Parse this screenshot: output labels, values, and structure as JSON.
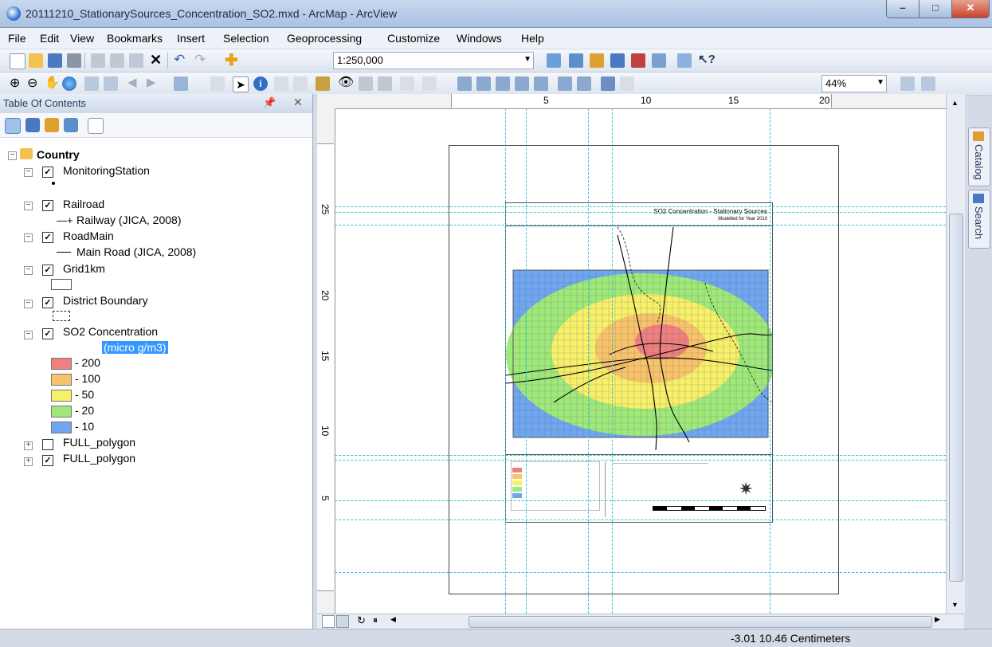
{
  "window": {
    "title": "20111210_StationarySources_Concentration_SO2.mxd - ArcMap - ArcView"
  },
  "menu": [
    "File",
    "Edit",
    "View",
    "Bookmarks",
    "Insert",
    "Selection",
    "Geoprocessing",
    "Customize",
    "Windows",
    "Help"
  ],
  "toolbar": {
    "scale": "1:250,000",
    "zoom": "44%"
  },
  "toc": {
    "title": "Table Of Contents",
    "root": "Country",
    "layers": [
      {
        "name": "MonitoringStation",
        "checked": true
      },
      {
        "name": "Railroad",
        "checked": true,
        "legend": "Railway (JICA, 2008)"
      },
      {
        "name": "RoadMain",
        "checked": true,
        "legend": "Main Road (JICA, 2008)"
      },
      {
        "name": "Grid1km",
        "checked": true
      },
      {
        "name": "District Boundary",
        "checked": true
      },
      {
        "name": "SO2 Concentration",
        "checked": true,
        "field": "(micro g/m3)"
      },
      {
        "name": "FULL_polygon",
        "checked": false
      },
      {
        "name": "FULL_polygon",
        "checked": true
      }
    ],
    "so2_classes": [
      {
        "label": "- 200",
        "color": "#f08080"
      },
      {
        "label": "- 100",
        "color": "#f7c36b"
      },
      {
        "label": "- 50",
        "color": "#f7f06b"
      },
      {
        "label": "- 20",
        "color": "#9fe87a"
      },
      {
        "label": "- 10",
        "color": "#6fa6ef"
      }
    ]
  },
  "ruler": {
    "top": [
      "5",
      "10",
      "15",
      "20"
    ],
    "left": [
      "25",
      "20",
      "15",
      "10",
      "5"
    ]
  },
  "map": {
    "title": "SO2 Concentration - Stationary Sources",
    "subtitle": "Modelled for Year 2010"
  },
  "side_tabs": [
    "Catalog",
    "Search"
  ],
  "status": {
    "coords": "-3.01  10.46 Centimeters"
  }
}
